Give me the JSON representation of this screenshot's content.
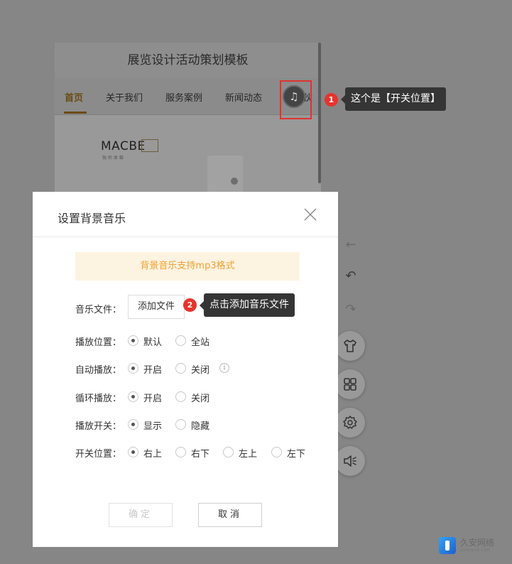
{
  "preview": {
    "title": "展览设计活动策划模板",
    "nav": [
      "首页",
      "关于我们",
      "服务案例",
      "新闻动态",
      "合作伙"
    ],
    "logo_text": "MACBE",
    "logo_sub": "独 烈 体 箱"
  },
  "annotations": {
    "marker1": "1",
    "tip1": "这个是【开关位置】",
    "marker2": "2",
    "tip2": "点击添加音乐文件"
  },
  "dialog": {
    "title": "设置背景音乐",
    "notice": "背景音乐支持mp3格式",
    "music_file_label": "音乐文件：",
    "add_file_button": "添加文件",
    "rows": [
      {
        "label": "播放位置：",
        "options": [
          {
            "text": "默认",
            "selected": true
          },
          {
            "text": "全站",
            "selected": false
          }
        ]
      },
      {
        "label": "自动播放：",
        "options": [
          {
            "text": "开启",
            "selected": true
          },
          {
            "text": "关闭",
            "selected": false
          }
        ]
      },
      {
        "label": "循环播放：",
        "options": [
          {
            "text": "开启",
            "selected": true
          },
          {
            "text": "关闭",
            "selected": false
          }
        ]
      },
      {
        "label": "播放开关：",
        "options": [
          {
            "text": "显示",
            "selected": true
          },
          {
            "text": "隐藏",
            "selected": false
          }
        ]
      },
      {
        "label": "开关位置：",
        "options": [
          {
            "text": "右上",
            "selected": true
          },
          {
            "text": "右下",
            "selected": false
          },
          {
            "text": "左上",
            "selected": false
          },
          {
            "text": "左下",
            "selected": false
          }
        ]
      }
    ],
    "info_icon": "i",
    "ok_button": "确定",
    "cancel_button": "取消"
  },
  "toolbar": {
    "icons": [
      "back-arrow-icon",
      "undo-icon",
      "redo-icon",
      "shirt-icon",
      "grid-icon",
      "settings-icon",
      "speaker-icon"
    ]
  },
  "watermark": {
    "name": "久安网络",
    "url": "jiuanweb.com"
  },
  "colors": {
    "accent": "#f0a030",
    "notice_bg": "#fdf3e1",
    "marker": "#e5342d",
    "tooltip_bg": "#353535"
  }
}
